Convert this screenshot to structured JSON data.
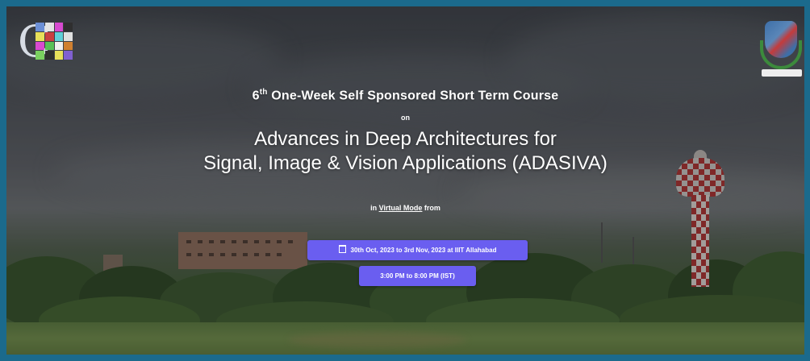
{
  "course": {
    "edition_number": "6",
    "edition_suffix": "th",
    "course_name": " One-Week Self Sponsored Short Term Course",
    "connector": "on",
    "title_line_1": "Advances in Deep Architectures for",
    "title_line_2": "Signal, Image & Vision Applications (ADASIVA)"
  },
  "mode": {
    "prefix": "in ",
    "link_label": "Virtual Mode",
    "suffix": " from"
  },
  "buttons": {
    "date_label": "30th Oct, 2023 to 3rd Nov, 2023 at IIIT Allahabad",
    "time_label": "3:00 PM to 8:00 PM (IST)"
  },
  "colors": {
    "frame_border": "#1b6a8c",
    "button_bg": "#6a5ef0",
    "text": "#ffffff"
  },
  "icons": {
    "left_logo": "cvbl-logo-icon",
    "right_logo": "institute-emblem-icon",
    "date_button_icon": "calendar-icon"
  }
}
